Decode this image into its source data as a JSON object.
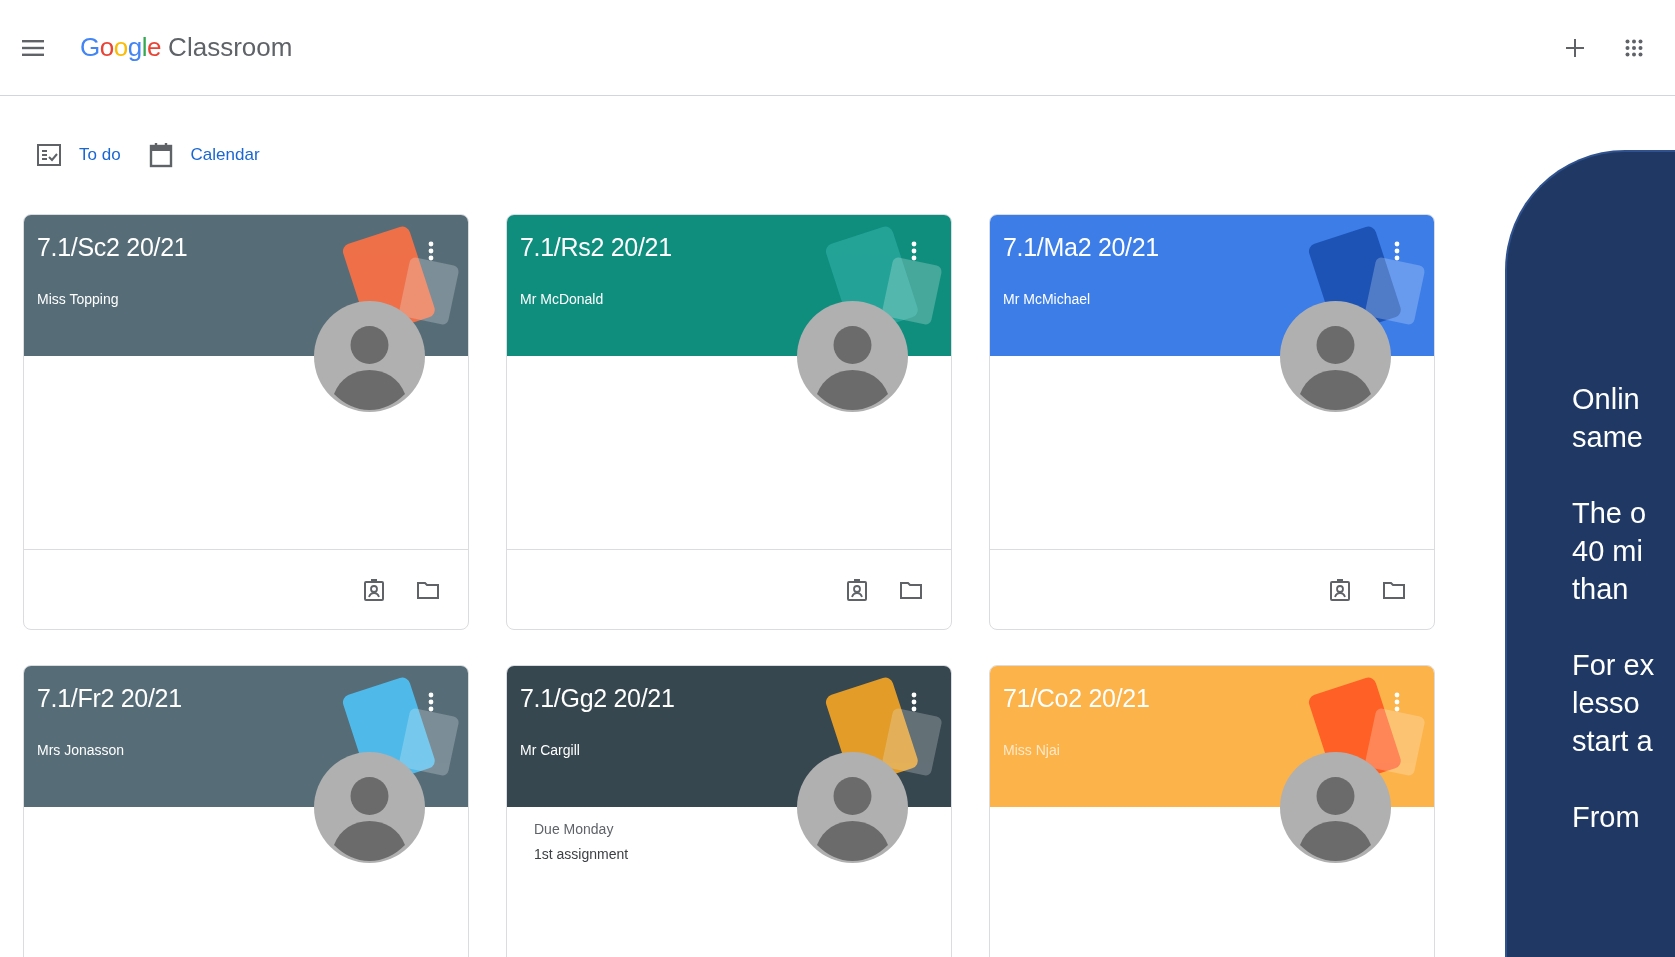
{
  "header": {
    "brand": "Google",
    "product": "Classroom"
  },
  "nav_links": [
    {
      "kind": "todo",
      "label": "To do"
    },
    {
      "kind": "calendar",
      "label": "Calendar"
    }
  ],
  "classes": [
    {
      "title": "7.1/Sc2 20/21",
      "teacher": "Miss Topping",
      "color": "#566d78"
    },
    {
      "title": "7.1/Rs2 20/21",
      "teacher": "Mr McDonald",
      "color": "#0f8e7e"
    },
    {
      "title": "7.1/Ma2 20/21",
      "teacher": "Mr McMichael",
      "color": "#3c7de8"
    },
    {
      "title": "7.1/Fr2 20/21",
      "teacher": "Mrs Jonasson",
      "color": "#566d78"
    },
    {
      "title": "7.1/Gg2 20/21",
      "teacher": "Mr Cargill",
      "color": "#37474f",
      "due": "Due Monday",
      "assignment": "1st assignment"
    },
    {
      "title": "71/Co2 20/21",
      "teacher": "Miss Njai",
      "color": "#fcb34a"
    }
  ],
  "callout": {
    "paragraphs": [
      [
        "Onlin",
        "same"
      ],
      [
        "The o",
        "40 mi",
        "than"
      ],
      [
        "For ex",
        "lesso",
        "start a"
      ],
      [
        "From"
      ]
    ]
  }
}
